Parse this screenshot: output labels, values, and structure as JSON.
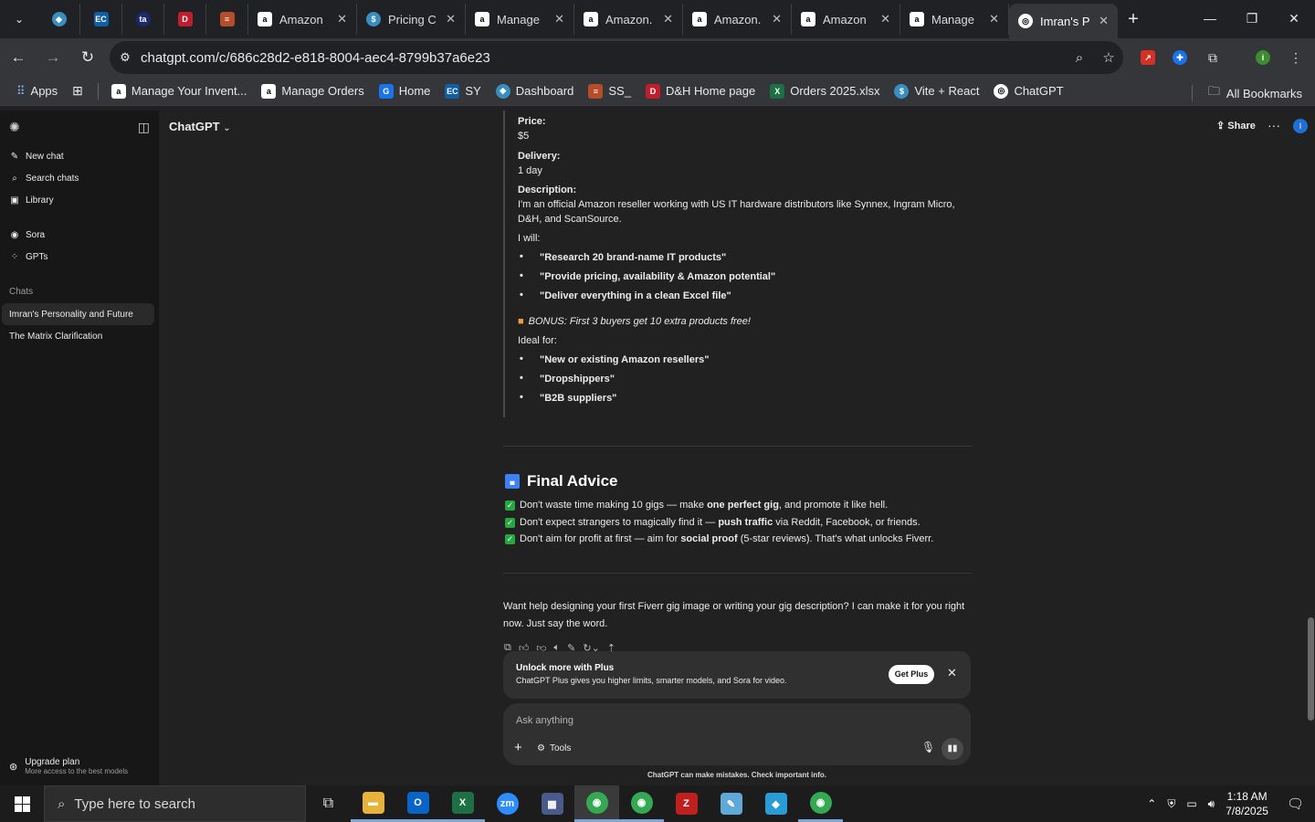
{
  "browser": {
    "tabs": [
      {
        "label": "Amazon",
        "icon": "amazon-icon"
      },
      {
        "label": "Pricing C",
        "icon": "dollar-icon"
      },
      {
        "label": "Manage",
        "icon": "amazon-icon"
      },
      {
        "label": "Amazon.",
        "icon": "amazon-icon"
      },
      {
        "label": "Amazon.",
        "icon": "amazon-icon"
      },
      {
        "label": "Amazon",
        "icon": "amazon-icon"
      },
      {
        "label": "Manage",
        "icon": "amazon-icon"
      },
      {
        "label": "Imran's P",
        "icon": "chatgpt-icon"
      }
    ],
    "url": "chatgpt.com/c/686c28d2-e818-8004-aec4-8799b37a6e23",
    "bookmarks": [
      "Apps",
      "Manage Your Invent...",
      "Manage Orders",
      "Home",
      "SY",
      "Dashboard",
      "SS_",
      "D&H Home page",
      "Orders 2025.xlsx",
      "Vite + React",
      "ChatGPT"
    ],
    "all_bookmarks": "All Bookmarks",
    "profile_initial": "i"
  },
  "sidebar": {
    "new_chat": "New chat",
    "search_chats": "Search chats",
    "library": "Library",
    "sora": "Sora",
    "gpts": "GPTs",
    "chats_header": "Chats",
    "chats": [
      "Imran's Personality and Future",
      "The Matrix Clarification"
    ],
    "upgrade_title": "Upgrade plan",
    "upgrade_sub": "More access to the best models"
  },
  "header": {
    "model": "ChatGPT",
    "share": "Share",
    "avatar": "I"
  },
  "gig": {
    "price_label": "Price:",
    "price": "$5",
    "delivery_label": "Delivery:",
    "delivery": "1 day",
    "description_label": "Description:",
    "description": "I'm an official Amazon reseller working with US IT hardware distributors like Synnex, Ingram Micro, D&H, and ScanSource.",
    "i_will": "I will:",
    "will_items": [
      "\"Research 20 brand-name IT products\"",
      "\"Provide pricing, availability & Amazon potential\"",
      "\"Deliver everything in a clean Excel file\""
    ],
    "bonus": "BONUS: First 3 buyers get 10 extra products free!",
    "ideal_for": "Ideal for:",
    "ideal_items": [
      "\"New or existing Amazon resellers\"",
      "\"Dropshippers\"",
      "\"B2B suppliers\""
    ]
  },
  "final_advice": {
    "title": "Final Advice",
    "items": [
      {
        "a": "Don't waste time making 10 gigs — make ",
        "b": "one perfect gig",
        "c": ", and promote it like hell."
      },
      {
        "a": "Don't expect strangers to magically find it — ",
        "b": "push traffic",
        "c": " via Reddit, Facebook, or friends."
      },
      {
        "a": "Don't aim for profit at first — aim for ",
        "b": "social proof",
        "c": " (5-star reviews). That's what unlocks Fiverr."
      }
    ]
  },
  "closing": "Want help designing your first Fiverr gig image or writing your gig description? I can make it for you right now. Just say the word.",
  "upsell": {
    "title": "Unlock more with Plus",
    "subtitle": "ChatGPT Plus gives you higher limits, smarter models, and Sora for video.",
    "button": "Get Plus"
  },
  "composer": {
    "placeholder": "Ask anything",
    "tools": "Tools"
  },
  "disclaimer": "ChatGPT can make mistakes. Check important info.",
  "taskbar": {
    "search_placeholder": "Type here to search",
    "time": "1:18 AM",
    "date": "7/8/2025"
  },
  "colors": {
    "accent": "#1f6fd6",
    "check": "#26a641",
    "bg": "#212121",
    "sidebar": "#171717"
  }
}
